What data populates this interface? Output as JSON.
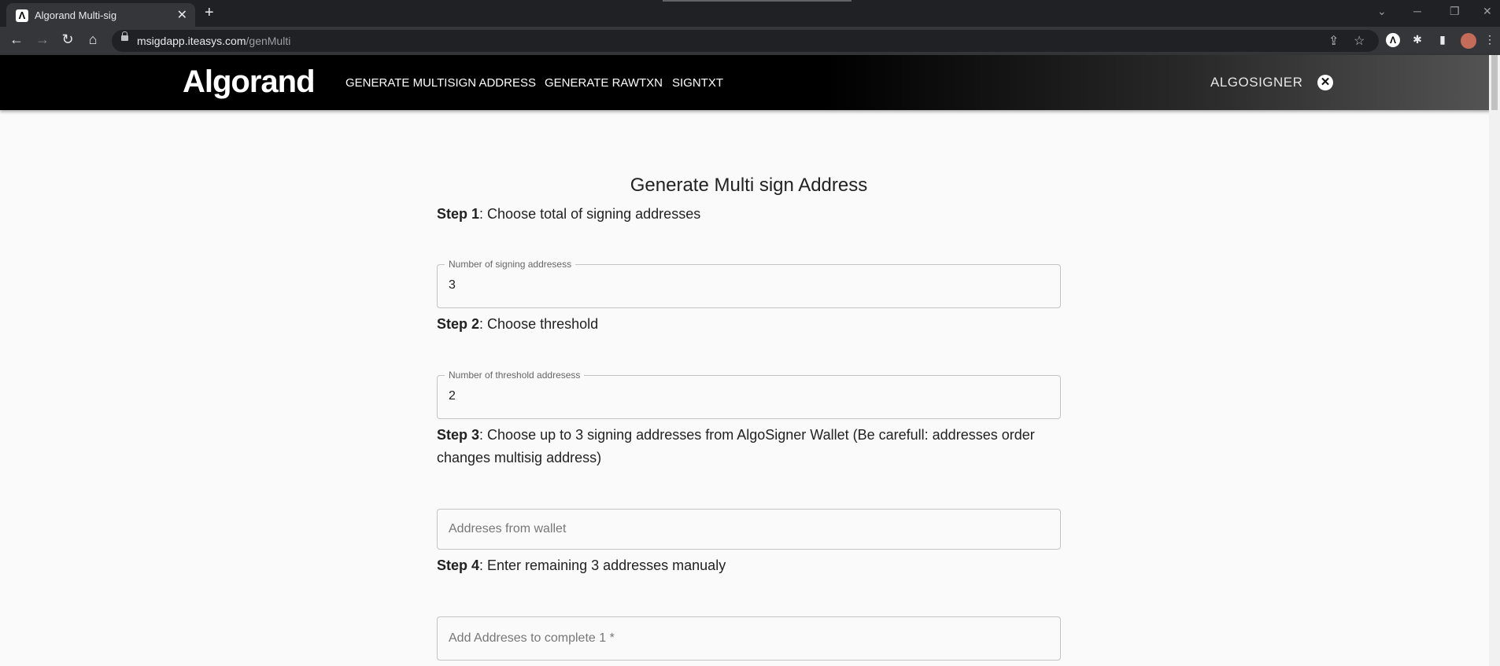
{
  "browser": {
    "tab_title": "Algorand Multi-sig",
    "tab_close": "✕",
    "new_tab": "+",
    "url_domain": "msigdapp.iteasys.com",
    "url_path": "/genMulti",
    "favicon_letter": "Λ"
  },
  "icons": {
    "back": "←",
    "forward": "→",
    "reload": "↻",
    "home": "⌂",
    "share": "⇪",
    "star": "☆",
    "puzzle": "✱",
    "sidebar": "▮",
    "chevron": "⌄",
    "minimize": "─",
    "restore": "❐",
    "close_window": "✕",
    "more": "⋮",
    "ext_algo": "Λ"
  },
  "app": {
    "logo": "Algorand",
    "nav": [
      "GENERATE MULTISIGN ADDRESS",
      "GENERATE RAWTXN",
      "SIGNTXT"
    ],
    "signer_logo": "ALGOSIGNER",
    "close_symbol": "✕"
  },
  "form": {
    "title": "Generate Multi sign Address",
    "step1": {
      "label": "Step 1",
      "text": ": Choose total of signing addresses"
    },
    "signing_field": {
      "legend": "Number of signing addresess",
      "value": "3"
    },
    "step2": {
      "label": "Step 2",
      "text": ": Choose threshold"
    },
    "threshold_field": {
      "legend": "Number of threshold addresess",
      "value": "2"
    },
    "step3": {
      "label": "Step 3",
      "text": ": Choose up to 3 signing addresses from AlgoSigner Wallet (Be carefull: addresses order changes multisig address)"
    },
    "wallet_field": {
      "placeholder": "Addreses from wallet"
    },
    "step4": {
      "label": "Step 4",
      "text": ": Enter remaining 3 addresses manualy"
    },
    "manual_field": {
      "placeholder": "Add Addreses to complete 1 *"
    }
  }
}
